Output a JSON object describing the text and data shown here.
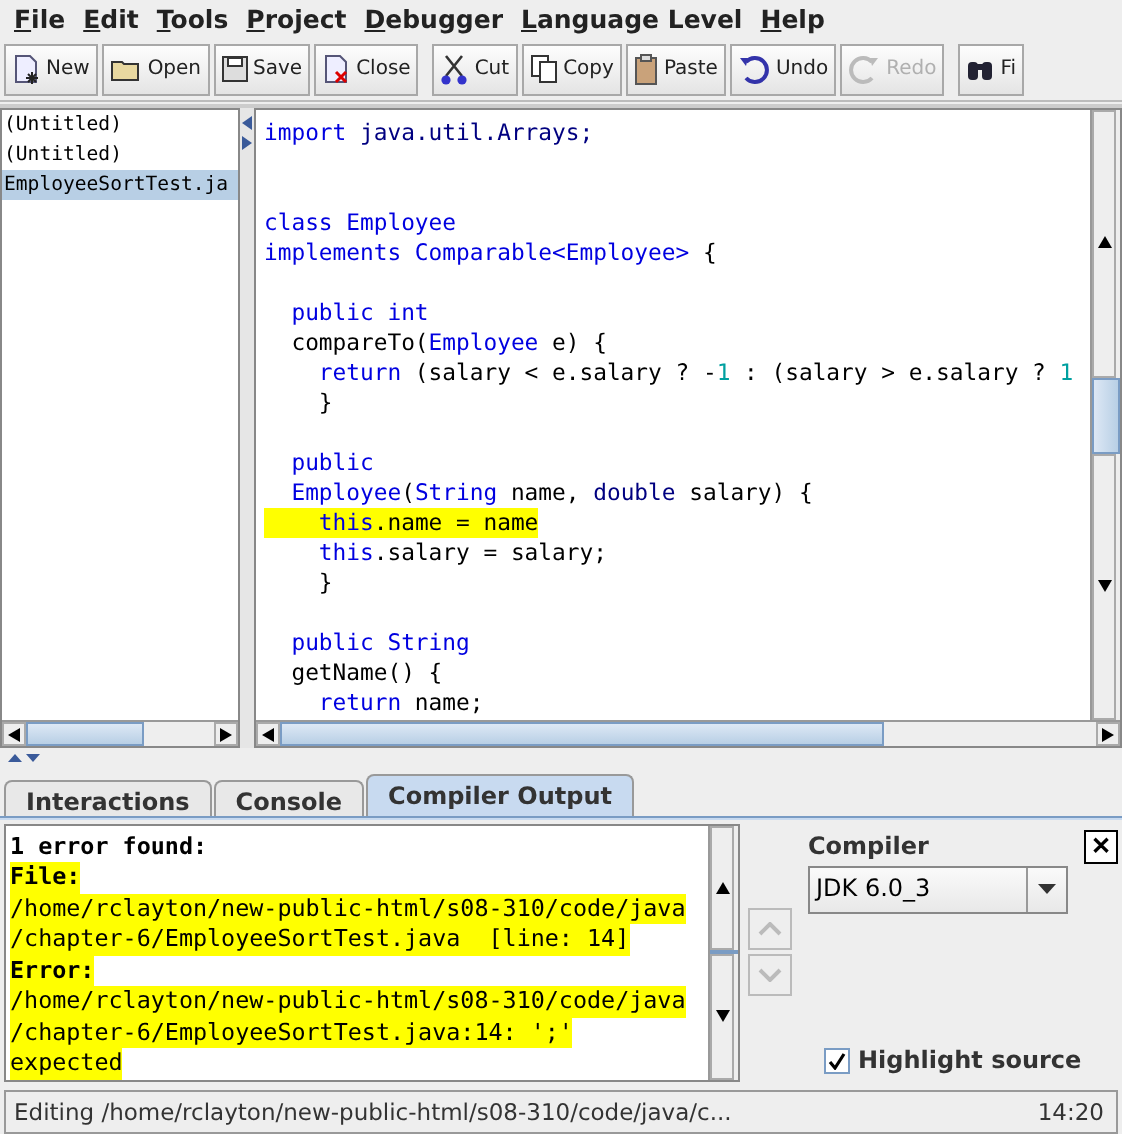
{
  "menu": [
    "File",
    "Edit",
    "Tools",
    "Project",
    "Debugger",
    "Language Level",
    "Help"
  ],
  "toolbar": [
    {
      "label": "New",
      "disabled": false
    },
    {
      "label": "Open",
      "disabled": false
    },
    {
      "label": "Save",
      "disabled": false
    },
    {
      "label": "Close",
      "disabled": false
    },
    {
      "label": "Cut",
      "disabled": false
    },
    {
      "label": "Copy",
      "disabled": false
    },
    {
      "label": "Paste",
      "disabled": false
    },
    {
      "label": "Undo",
      "disabled": false
    },
    {
      "label": "Redo",
      "disabled": true
    },
    {
      "label": "Fi",
      "disabled": false
    }
  ],
  "documents": [
    {
      "name": "(Untitled)",
      "selected": false
    },
    {
      "name": "(Untitled)",
      "selected": false
    },
    {
      "name": "EmployeeSortTest.ja",
      "selected": true
    }
  ],
  "editor": {
    "imports": [
      {
        "highlighted": false,
        "tokens": [
          {
            "kind": "kw",
            "text": "import "
          },
          {
            "kind": "ident",
            "text": "java.util.Arrays;"
          }
        ]
      }
    ],
    "blocks": [
      [
        {
          "highlighted": false,
          "tokens": [
            {
              "kind": "kw",
              "text": "class Employee"
            }
          ]
        },
        {
          "highlighted": false,
          "tokens": [
            {
              "kind": "kw",
              "text": "implements Comparable<Employee>"
            },
            {
              "kind": "plain",
              "text": " {"
            }
          ]
        }
      ],
      [
        {
          "highlighted": false,
          "tokens": [
            {
              "kind": "kw",
              "text": "  public int"
            }
          ]
        },
        {
          "highlighted": false,
          "tokens": [
            {
              "kind": "plain",
              "text": "  compareTo("
            },
            {
              "kind": "kw",
              "text": "Employee"
            },
            {
              "kind": "plain",
              "text": " e) {"
            }
          ]
        },
        {
          "highlighted": false,
          "tokens": [
            {
              "kind": "kw",
              "text": "    return"
            },
            {
              "kind": "plain",
              "text": " (salary < e.salary ? -"
            },
            {
              "kind": "num",
              "text": "1"
            },
            {
              "kind": "plain",
              "text": " : (salary > e.salary ? "
            },
            {
              "kind": "num",
              "text": "1"
            }
          ]
        },
        {
          "highlighted": false,
          "tokens": [
            {
              "kind": "plain",
              "text": "    }"
            }
          ]
        }
      ],
      [
        {
          "highlighted": false,
          "tokens": [
            {
              "kind": "kw",
              "text": "  public"
            }
          ]
        },
        {
          "highlighted": false,
          "tokens": [
            {
              "kind": "kw",
              "text": "  Employee"
            },
            {
              "kind": "plain",
              "text": "("
            },
            {
              "kind": "kw",
              "text": "String"
            },
            {
              "kind": "plain",
              "text": " name, "
            },
            {
              "kind": "ident",
              "text": "double"
            },
            {
              "kind": "plain",
              "text": " salary) {"
            }
          ]
        },
        {
          "highlighted": true,
          "tokens": [
            {
              "kind": "kw",
              "text": "    this"
            },
            {
              "kind": "plain",
              "text": ".name = name"
            }
          ]
        },
        {
          "highlighted": false,
          "tokens": [
            {
              "kind": "kw",
              "text": "    this"
            },
            {
              "kind": "plain",
              "text": ".salary = salary;"
            }
          ]
        },
        {
          "highlighted": false,
          "tokens": [
            {
              "kind": "plain",
              "text": "    }"
            }
          ]
        }
      ],
      [
        {
          "highlighted": false,
          "tokens": [
            {
              "kind": "kw",
              "text": "  public String"
            }
          ]
        },
        {
          "highlighted": false,
          "tokens": [
            {
              "kind": "plain",
              "text": "  getName() {"
            }
          ]
        },
        {
          "highlighted": false,
          "tokens": [
            {
              "kind": "kw",
              "text": "    return"
            },
            {
              "kind": "plain",
              "text": " name;"
            }
          ]
        }
      ]
    ]
  },
  "tabs": [
    {
      "label": "Interactions",
      "selected": false
    },
    {
      "label": "Console",
      "selected": false
    },
    {
      "label": "Compiler Output",
      "selected": true
    }
  ],
  "compiler_output": [
    {
      "kind": "heading",
      "text": "1 error found:",
      "highlighted": false
    },
    {
      "kind": "heading",
      "text": "File:",
      "highlighted": true
    },
    {
      "kind": "text",
      "text": "/home/rclayton/new-public-html/s08-310/code/java",
      "highlighted": true
    },
    {
      "kind": "text",
      "text": "/chapter-6/EmployeeSortTest.java  [line: 14]",
      "highlighted": true
    },
    {
      "kind": "heading",
      "text": "Error:",
      "highlighted": true
    },
    {
      "kind": "text",
      "text": "/home/rclayton/new-public-html/s08-310/code/java",
      "highlighted": true
    },
    {
      "kind": "text",
      "text": "/chapter-6/EmployeeSortTest.java:14: ';'",
      "highlighted": true
    },
    {
      "kind": "text",
      "text": "expected",
      "highlighted": true
    }
  ],
  "compiler": {
    "label": "Compiler",
    "value": "JDK 6.0_3",
    "highlight_source": {
      "label": "Highlight source",
      "checked": true
    },
    "close": "✕"
  },
  "status_bar": {
    "message": "Editing /home/rclayton/new-public-html/s08-310/code/java/c...",
    "position": "14:20"
  }
}
